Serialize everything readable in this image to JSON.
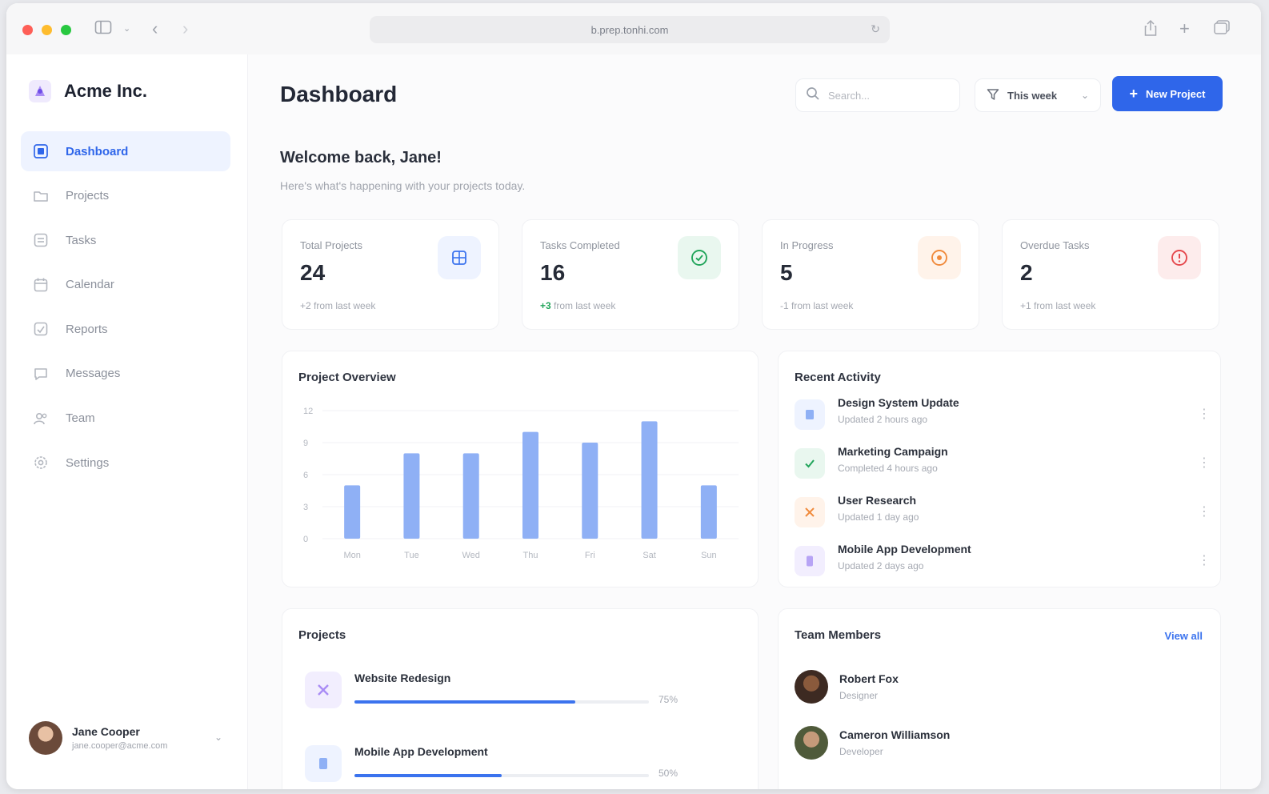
{
  "browser": {
    "url": "b.prep.tonhi.com"
  },
  "sidebar": {
    "brand": "Acme Inc.",
    "items": [
      {
        "label": "Dashboard",
        "icon": "dashboard-icon",
        "active": true
      },
      {
        "label": "Projects",
        "icon": "folder-icon"
      },
      {
        "label": "Tasks",
        "icon": "tasks-icon"
      },
      {
        "label": "Calendar",
        "icon": "calendar-icon"
      },
      {
        "label": "Reports",
        "icon": "reports-icon"
      },
      {
        "label": "Messages",
        "icon": "messages-icon"
      },
      {
        "label": "Team",
        "icon": "team-icon"
      },
      {
        "label": "Settings",
        "icon": "settings-icon"
      }
    ],
    "user": {
      "name": "Jane Cooper",
      "email": "jane.cooper@acme.com"
    }
  },
  "header": {
    "title": "Dashboard",
    "search_placeholder": "Search...",
    "filter_label": "This week",
    "new_project_label": "New Project"
  },
  "welcome": {
    "title": "Welcome back, Jane!",
    "subtitle": "Here's what's happening with your projects today."
  },
  "stats": [
    {
      "label": "Total Projects",
      "value": "24",
      "change_delta": "+2",
      "change_rest": " from last week",
      "icon": "grid-icon",
      "color": "#3b73ee",
      "bg": "#eef3ff"
    },
    {
      "label": "Tasks Completed",
      "value": "16",
      "change_delta": "+3",
      "change_rest": " from last week",
      "icon": "check-circle-icon",
      "color": "#22a55b",
      "bg": "#e9f7ef"
    },
    {
      "label": "In Progress",
      "value": "5",
      "change_delta": "-1",
      "change_rest": " from last week",
      "icon": "clock-icon",
      "color": "#f08a3c",
      "bg": "#fff3ea"
    },
    {
      "label": "Overdue Tasks",
      "value": "2",
      "change_delta": "+1",
      "change_rest": " from last week",
      "icon": "alert-icon",
      "color": "#e5484d",
      "bg": "#fdecec"
    }
  ],
  "overview": {
    "title": "Project Overview"
  },
  "chart_data": {
    "type": "bar",
    "title": "Project Overview",
    "categories": [
      "Mon",
      "Tue",
      "Wed",
      "Thu",
      "Fri",
      "Sat",
      "Sun"
    ],
    "values": [
      5,
      8,
      8,
      10,
      9,
      11,
      5
    ],
    "yticks": [
      0,
      3,
      6,
      9,
      12
    ],
    "ylim": [
      0,
      12
    ],
    "grid": true,
    "color": "#8fb0f5"
  },
  "activity": {
    "title": "Recent Activity",
    "items": [
      {
        "title": "Design System Update",
        "sub": "Updated 2 hours ago",
        "icon": "document-icon",
        "color": "#3b73ee",
        "bg": "#eef3ff"
      },
      {
        "title": "Marketing Campaign",
        "sub": "Completed 4 hours ago",
        "icon": "check-icon",
        "color": "#22a55b",
        "bg": "#e9f7ef"
      },
      {
        "title": "User Research",
        "sub": "Updated 1 day ago",
        "icon": "research-icon",
        "color": "#f08a3c",
        "bg": "#fff3ea"
      },
      {
        "title": "Mobile App Development",
        "sub": "Updated 2 days ago",
        "icon": "mobile-icon",
        "color": "#8b6cf0",
        "bg": "#f2eefe"
      }
    ]
  },
  "projects": {
    "title": "Projects",
    "items": [
      {
        "name": "Website Redesign",
        "progress": 75,
        "progress_label": "75%",
        "icon": "design-icon",
        "color": "#8b6cf0",
        "bg": "#f2eefe"
      },
      {
        "name": "Mobile App Development",
        "progress": 50,
        "progress_label": "50%",
        "icon": "mobile-icon",
        "color": "#3b73ee",
        "bg": "#eef3ff"
      }
    ]
  },
  "team": {
    "title": "Team Members",
    "view_all": "View all",
    "members": [
      {
        "name": "Robert Fox",
        "role": "Designer"
      },
      {
        "name": "Cameron Williamson",
        "role": "Developer"
      }
    ]
  }
}
